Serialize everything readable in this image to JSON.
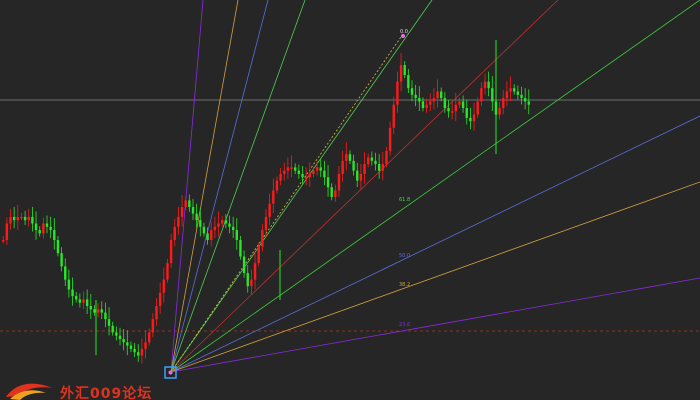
{
  "colors": {
    "background": "#262626",
    "bull": "#ff1a1a",
    "bear": "#26e826",
    "price_line": "#6e6e6e",
    "dashed_level": "#a83a2a",
    "marker": "#3aa0ff",
    "logo": "#e0321e"
  },
  "chart_data": {
    "type": "candlestick",
    "fan_labels": [
      "61.8",
      "50.0",
      "38.2",
      "23.6"
    ],
    "peak_label": "0.0",
    "watermark": "外汇009论坛",
    "price_path": [
      0.4,
      0.45,
      0.47,
      0.46,
      0.47,
      0.47,
      0.46,
      0.47,
      0.45,
      0.43,
      0.42,
      0.45,
      0.44,
      0.43,
      0.4,
      0.36,
      0.32,
      0.28,
      0.25,
      0.23,
      0.22,
      0.21,
      0.22,
      0.2,
      0.19,
      0.18,
      0.19,
      0.18,
      0.16,
      0.14,
      0.12,
      0.11,
      0.1,
      0.09,
      0.08,
      0.07,
      0.06,
      0.05,
      0.07,
      0.09,
      0.12,
      0.16,
      0.2,
      0.24,
      0.28,
      0.33,
      0.4,
      0.44,
      0.47,
      0.5,
      0.52,
      0.5,
      0.48,
      0.46,
      0.44,
      0.42,
      0.4,
      0.43,
      0.44,
      0.45,
      0.46,
      0.45,
      0.44,
      0.43,
      0.4,
      0.35,
      0.3,
      0.26,
      0.28,
      0.33,
      0.38,
      0.43,
      0.47,
      0.51,
      0.55,
      0.58,
      0.6,
      0.61,
      0.62,
      0.62,
      0.61,
      0.6,
      0.59,
      0.59,
      0.6,
      0.61,
      0.62,
      0.61,
      0.59,
      0.56,
      0.53,
      0.55,
      0.6,
      0.64,
      0.66,
      0.64,
      0.61,
      0.58,
      0.6,
      0.63,
      0.65,
      0.64,
      0.63,
      0.61,
      0.63,
      0.67,
      0.74,
      0.81,
      0.88,
      0.93,
      0.9,
      0.86,
      0.84,
      0.83,
      0.82,
      0.8,
      0.81,
      0.82,
      0.83,
      0.85,
      0.83,
      0.8,
      0.79,
      0.79,
      0.81,
      0.82,
      0.8,
      0.77,
      0.76,
      0.78,
      0.82,
      0.86,
      0.88,
      0.86,
      0.82,
      0.78,
      0.8,
      0.83,
      0.85,
      0.86,
      0.85,
      0.84,
      0.83,
      0.82,
      0.81
    ]
  }
}
